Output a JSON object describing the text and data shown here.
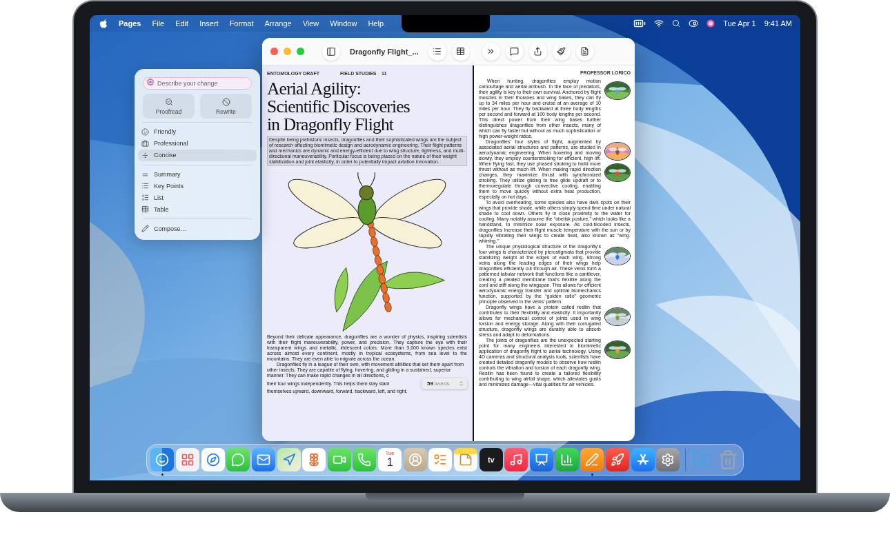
{
  "menu_bar": {
    "app_name": "Pages",
    "menus": [
      "File",
      "Edit",
      "Insert",
      "Format",
      "Arrange",
      "View",
      "Window",
      "Help"
    ],
    "date": "Tue Apr 1",
    "time": "9:41 AM"
  },
  "writing_tools": {
    "prompt": {
      "placeholder": "Describe your change"
    },
    "actions": [
      {
        "label": "Proofread",
        "kind": "proofread"
      },
      {
        "label": "Rewrite",
        "kind": "rewrite"
      }
    ],
    "tone_items": [
      {
        "label": "Friendly",
        "kind": "friendly",
        "selected": false
      },
      {
        "label": "Professional",
        "kind": "professional",
        "selected": false
      },
      {
        "label": "Concise",
        "kind": "concise",
        "selected": true
      }
    ],
    "format_items": [
      {
        "label": "Summary",
        "kind": "summary",
        "selected": false
      },
      {
        "label": "Key Points",
        "kind": "key_points",
        "selected": false
      },
      {
        "label": "List",
        "kind": "list",
        "selected": false
      },
      {
        "label": "Table",
        "kind": "table",
        "selected": false
      }
    ],
    "compose": {
      "label": "Compose…"
    }
  },
  "document_window": {
    "title": "Dragonfly Flight_...",
    "left_page": {
      "header": [
        "ENTOMOLOGY DRAFT",
        "FIELD STUDIES",
        "11"
      ],
      "title_lines": [
        "Aerial Agility:",
        "Scientific Discoveries",
        "in Dragonfly Flight"
      ],
      "abstract": {
        "text": "Despite being prehistoric insects, dragonflies and their sophisticated wings are the subject of research affecting biomimetic design and aerodynamic engineering. Their flight patterns and mechanics are dynamic and energy-efficient due to wing structure, lightness, and multi-directional maneuverability. Particular focus is being placed on the nature of their weight stabilization and joint elasticity, in order to potentially impact aviation innovation.",
        "selected": true
      },
      "body": "Beyond their delicate appearance, dragonflies are a wonder of physics, inspiring scientists with their flight maneuverability, power, and precision. They capture the eye with their transparent wings and metallic, iridescent colors. More than 3,000 known species exist across almost every continent, mostly in tropical ecosystems, from sea level to the mountains. They are even able to migrate across the ocean.",
      "second_paragraph": [
        "Dragonflies fly in a league of their own, with movement abilities that set them apart from other insects. They are capable of flying, hovering, and gliding in a sustained, superior manner. They can make rapid changes in all directions, c",
        "their four wings independently. This helps them stay stabl",
        "themselves upward, downward, forward, backward, left, and right."
      ],
      "word_count": "**59** words"
    },
    "right_page": {
      "header": "PROFESSOR LORICO",
      "paragraphs": [
        {
          "text": "When hunting, dragonflies employ motion camouflage and aerial ambush. In the face of predators, their agility is key to their own survival. Anchored by flight muscles in their thoraxes and wing bases, they can fly up to 34 miles per hour and cruise at an average of 10 miles per hour. They fly backward at three body lengths per second and forward at 100 body lengths per second. This direct power from their wing bases further distinguishes dragonflies from other insects, many of which can fly faster but without as much sophistication or high power-weight ratios."
        },
        {
          "text": "Dragonflies’ four styles of flight, augmented by associated aerial structures and patterns, are studied in aerodynamic engineering. When hovering and moving slowly, they employ counterstroking for efficient, high lift. When flying fast, they use phased stroking to build more thrust without as much lift. When making rapid direction changes, they maximize thrust with synchronized stroking. They utilize gliding to free glide updraft or to thermoregulate through convective cooling, enabling them to move quickly without extra heat production, especially on hot days."
        },
        {
          "text": "To avoid overheating, some species also have dark spots on their wings that provide shade, while others simply spend time under natural shade to cool down. Others fly in close proximity to the water for cooling. Many notably assume the “obelisk posture,” which looks like a handstand, to minimize solar exposure. As cold-blooded insects, dragonflies increase their flight muscle temperature with the sun or by rapidly vibrating their wings to create heat, also known as “wing-whirring.”"
        },
        {
          "text": "The unique physiological structure of the dragonfly’s four wings is characterized by pterostigmata that provide stabilizing weight at the edges of each wing. Strong veins along the leading edges of their wings help dragonflies efficiently cut through air. These veins form a patterned tabular network that functions like a cantilever, creating a pleated membrane that’s flexible along the cord and stiff along the wingspan. This allows for efficient aerodynamic energy transfer and optimal biomechanics function, supported by the “golden ratio” geometric principle observed in the veins’ pattern."
        },
        {
          "text": "Dragonfly wings have a protein called resilin that contributes to their flexibility and elasticity. It importantly allows for mechanical control of joints used in wing torsion and energy storage. Along with their corrugated structure, dragonfly wings are durably able to absorb stress and adapt to deformations."
        },
        {
          "text": "The joints of dragonflies are the unexpected starting point for many engineers interested in biomimetic application of dragonfly flight to aerial technology. Using 4D cameras and structural analysis tools, scientists have created detailed dragonfly models to observe how resilin controls the vibration and torsion of each dragonfly wing. Resilin has been found to create a tailored flexibility contributing to wing airfoil shape, which alleviates gusts and minimizes damage—vital qualities for air vehicles."
        }
      ]
    }
  },
  "dock": [
    {
      "kind": "finder",
      "running": true
    },
    {
      "kind": "launchpad",
      "running": false
    },
    {
      "kind": "safari",
      "running": false
    },
    {
      "kind": "messages",
      "running": false
    },
    {
      "kind": "mail",
      "running": false
    },
    {
      "kind": "maps",
      "running": false
    },
    {
      "kind": "photos",
      "running": false
    },
    {
      "kind": "facetime",
      "running": false
    },
    {
      "kind": "phone",
      "running": false
    },
    {
      "kind": "calendar",
      "running": false,
      "day": "Tue",
      "date": "1"
    },
    {
      "kind": "contacts",
      "running": false
    },
    {
      "kind": "reminders",
      "running": false
    },
    {
      "kind": "notes",
      "running": false
    },
    {
      "kind": "tv",
      "running": false,
      "label": "tv"
    },
    {
      "kind": "music",
      "running": false
    },
    {
      "kind": "keynote",
      "running": false
    },
    {
      "kind": "numbers",
      "running": false
    },
    {
      "kind": "pages",
      "running": true
    },
    {
      "kind": "games",
      "running": false
    },
    {
      "kind": "appstore",
      "running": false
    },
    {
      "kind": "settings",
      "running": false
    },
    {
      "kind": "separator"
    },
    {
      "kind": "downloads",
      "running": false
    },
    {
      "kind": "trash",
      "running": false
    }
  ]
}
